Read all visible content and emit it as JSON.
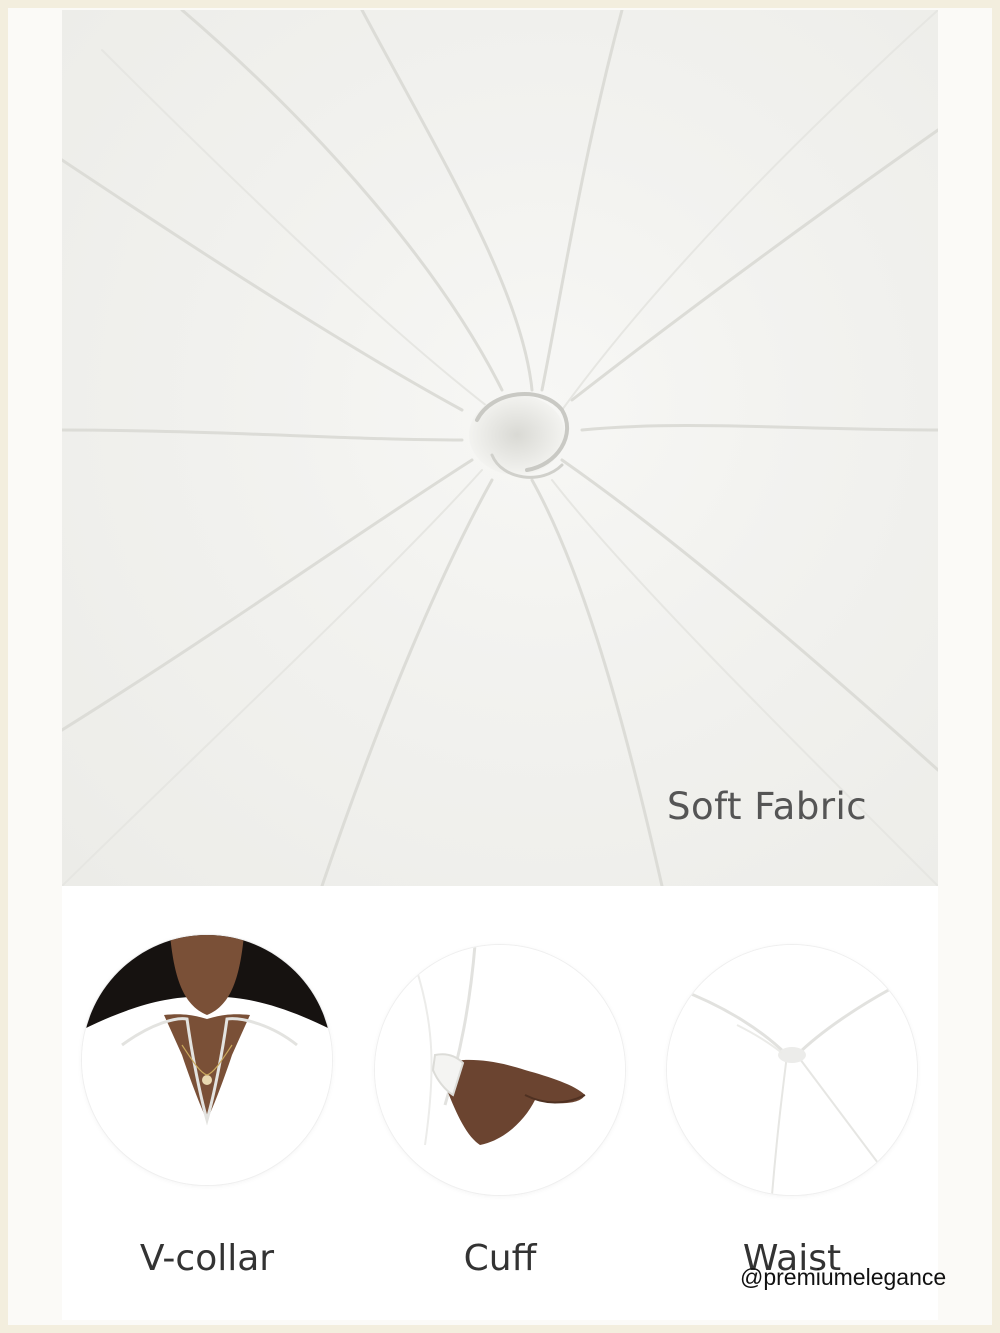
{
  "fabric": {
    "label": "Soft Fabric"
  },
  "details": [
    {
      "label": "V-collar"
    },
    {
      "label": "Cuff"
    },
    {
      "label": "Waist"
    }
  ],
  "watermark": "@premiumelegance"
}
